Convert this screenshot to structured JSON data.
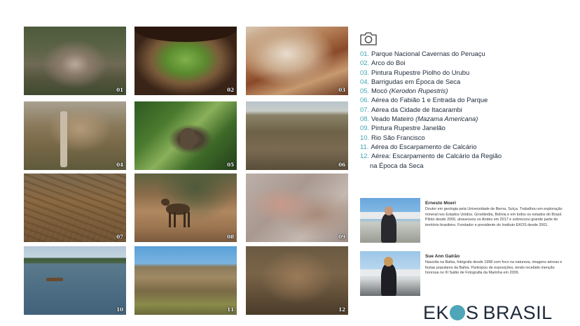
{
  "photos": [
    {
      "num": "01",
      "fill": "p01"
    },
    {
      "num": "02",
      "fill": "p02"
    },
    {
      "num": "03",
      "fill": "p03"
    },
    {
      "num": "04",
      "fill": "p04"
    },
    {
      "num": "05",
      "fill": "p05"
    },
    {
      "num": "06",
      "fill": "p06"
    },
    {
      "num": "07",
      "fill": "p07"
    },
    {
      "num": "08",
      "fill": "p08"
    },
    {
      "num": "09",
      "fill": "p09"
    },
    {
      "num": "10",
      "fill": "p10"
    },
    {
      "num": "11",
      "fill": "p11"
    },
    {
      "num": "12",
      "fill": "p12"
    }
  ],
  "legend": [
    {
      "num": "01.",
      "text": "Parque Nacional Cavernas do Peruaçu"
    },
    {
      "num": "02.",
      "text": "Arco do Boi"
    },
    {
      "num": "03.",
      "text": "Pintura Rupestre Piolho do Urubu"
    },
    {
      "num": "04.",
      "text": "Barrigudas em Época de Seca"
    },
    {
      "num": "05.",
      "text": "Mocó (Kerodon Rupestris)"
    },
    {
      "num": "06.",
      "text": "Aérea do Fabião 1 e Entrada do Parque"
    },
    {
      "num": "07.",
      "text": "Aérea da Cidade de Itacarambi"
    },
    {
      "num": "08.",
      "text": "Veado Mateiro (Mazama Americana)"
    },
    {
      "num": "09.",
      "text": "Pintura Rupestre Janelão"
    },
    {
      "num": "10.",
      "text": "Rio São Francisco"
    },
    {
      "num": "11.",
      "text": "Aérea do Escarpamento de Calcário"
    },
    {
      "num": "12.",
      "text": "Aérea: Escarpamento de Calcário da Região",
      "text2": "na Época da Seca"
    }
  ],
  "bios": [
    {
      "name": "Ernesto Moeri",
      "desc": "Doutor em geologia pela Universidade de Berna, Suíça. Trabalhou em exploração mineral nos Estados Unidos, Groelândia, Bolívia e em todos os estados do Brasil. Piloto desde 2006, atravessou os Andes em 2017 e sobrevoou grande parte do território brasileiro. Fundador e presidente do Instituto EKOS desde 2001."
    },
    {
      "name": "Sue Ann Galrão",
      "desc": "Nascida na Bahia, fotógrafa desde 1998 com foco na natureza, imagens aéreas e festas populares da Bahia. Participou de exposições, tendo recebido menção honrosa no III Salão de Fotografia da Marinha em 2009."
    }
  ],
  "logo": {
    "part1": "EK",
    "part2": "S",
    "part3": "BRASIL"
  },
  "colors": {
    "accent": "#4fa6b8",
    "text": "#1e2a3a"
  }
}
